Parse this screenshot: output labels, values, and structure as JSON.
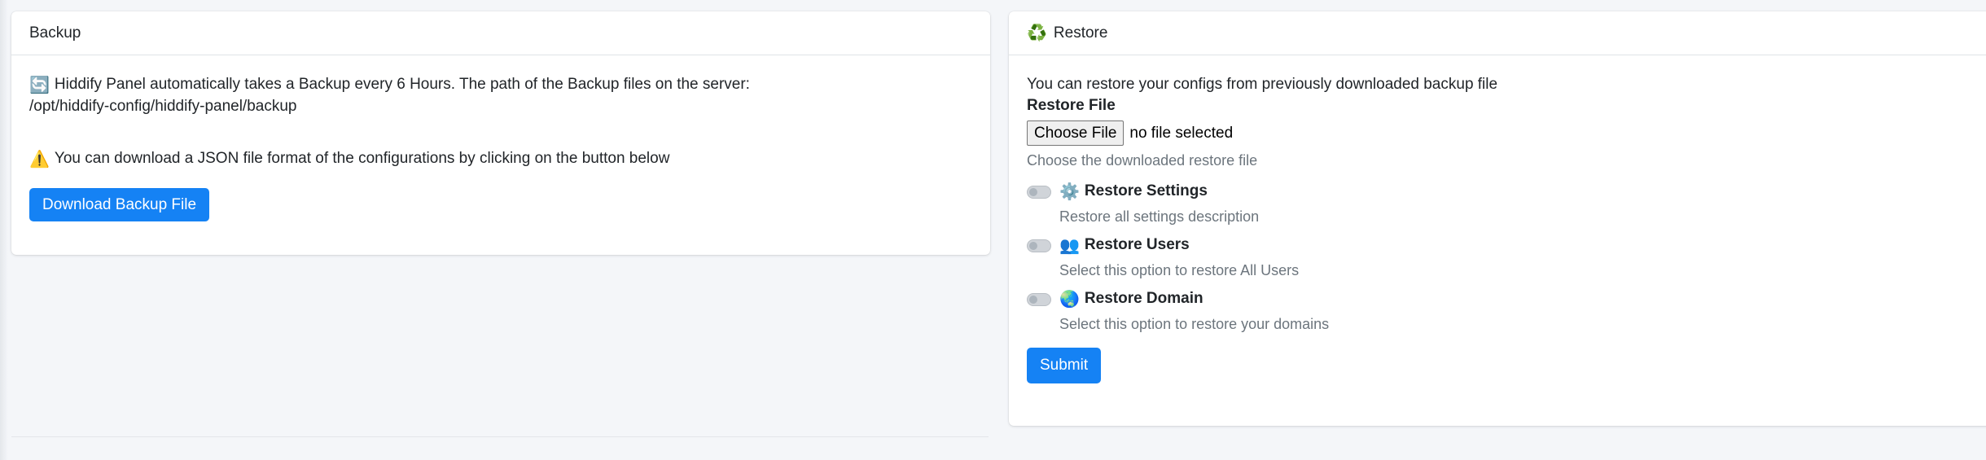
{
  "backup": {
    "title": "Backup",
    "info_icon": "🔄",
    "info_line1": "Hiddify Panel automatically takes a Backup every 6 Hours. The path of the Backup files on the server:",
    "info_line2": "/opt/hiddify-config/hiddify-panel/backup",
    "warning_icon": "⚠️",
    "warning_text": "You can download a JSON file format of the configurations by clicking on the button below",
    "download_button": "Download Backup File"
  },
  "restore": {
    "title": "Restore",
    "title_icon": "♻️",
    "intro": "You can restore your configs from previously downloaded backup file",
    "file_label": "Restore File",
    "file_button": "Choose File",
    "file_status": "no file selected",
    "file_help": "Choose the downloaded restore file",
    "options": [
      {
        "icon": "⚙️",
        "label": "Restore Settings",
        "description": "Restore all settings description",
        "checked": false
      },
      {
        "icon": "👥",
        "label": "Restore Users",
        "description": "Select this option to restore All Users",
        "checked": false
      },
      {
        "icon": "🌏",
        "label": "Restore Domain",
        "description": "Select this option to restore your domains",
        "checked": false
      }
    ],
    "submit_button": "Submit"
  },
  "colors": {
    "primary": "#1582f4",
    "background": "#f4f6f9",
    "muted_text": "#6c757d"
  }
}
